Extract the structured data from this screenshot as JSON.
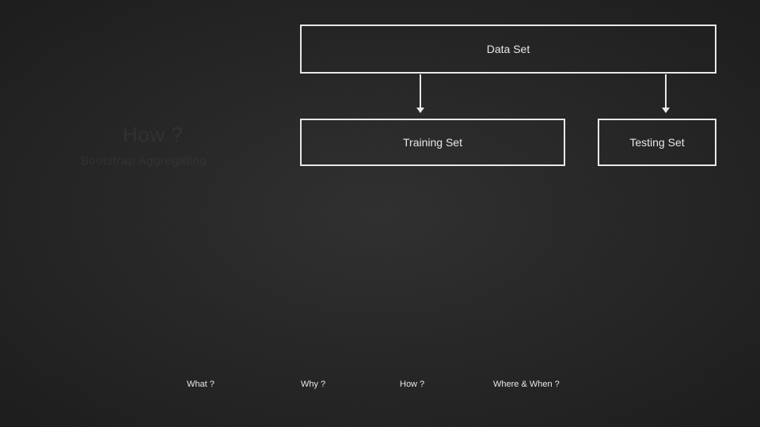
{
  "diagram": {
    "dataset_box": "Data Set",
    "training_box": "Training Set",
    "testing_box": "Testing Set"
  },
  "ghost": {
    "heading": "How ?",
    "sub": "Bootstrap Aggregating"
  },
  "nav": {
    "what": "What ?",
    "why": "Why ?",
    "how": "How ?",
    "where_when": "Where & When ?"
  }
}
